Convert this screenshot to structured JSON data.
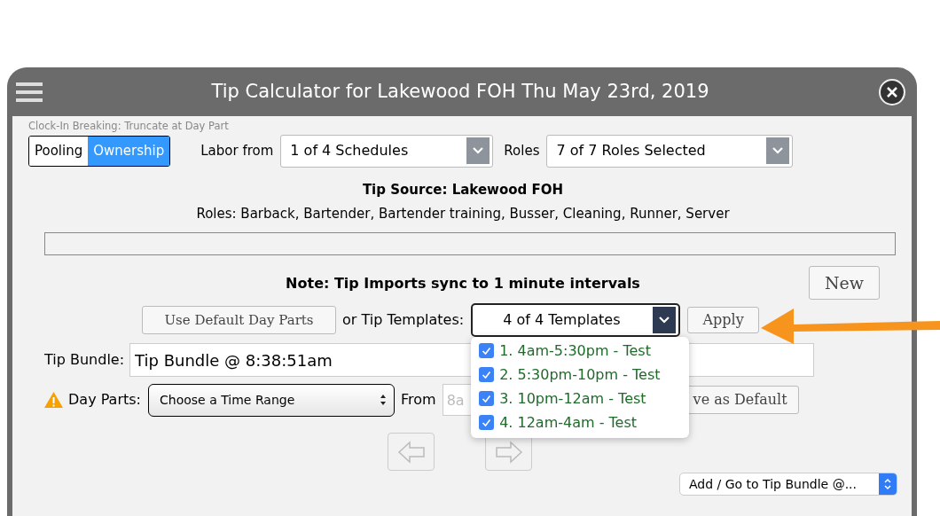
{
  "window": {
    "title": "Tip Calculator for Lakewood FOH Thu May 23rd, 2019"
  },
  "clock_in_note": "Clock-In Breaking: Truncate at Day Part",
  "mode_toggle": [
    {
      "label": "Pooling",
      "selected": false
    },
    {
      "label": "Ownership",
      "selected": true
    }
  ],
  "labor_from": {
    "label": "Labor from",
    "value": "1 of 4 Schedules"
  },
  "roles_filter": {
    "label": "Roles",
    "value": "7 of 7 Roles Selected"
  },
  "tip_source": {
    "title": "Tip Source: Lakewood FOH",
    "roles": "Roles: Barback, Bartender, Bartender training, Busser, Cleaning, Runner, Server"
  },
  "note": "Note: Tip Imports sync to 1 minute intervals",
  "new_button": "New",
  "default_day_parts_button": "Use Default Day Parts",
  "templates": {
    "label": "or Tip Templates:",
    "value": "4 of 4 Templates",
    "expanded": true,
    "options": [
      {
        "label": "1. 4am-5:30pm - Test",
        "checked": true
      },
      {
        "label": "2. 5:30pm-10pm - Test",
        "checked": true
      },
      {
        "label": "3. 10pm-12am - Test",
        "checked": true
      },
      {
        "label": "4. 12am-4am - Test",
        "checked": true
      }
    ]
  },
  "apply_button": "Apply",
  "tip_bundle": {
    "label": "Tip Bundle:",
    "value": "Tip Bundle @ 8:38:51am"
  },
  "day_parts": {
    "warning": true,
    "label": "Day Parts:",
    "value": "Choose a Time Range",
    "from_label": "From",
    "from_placeholder": "8a"
  },
  "save_default_button": "ve as Default",
  "bundle_select": "Add / Go to Tip Bundle @..."
}
